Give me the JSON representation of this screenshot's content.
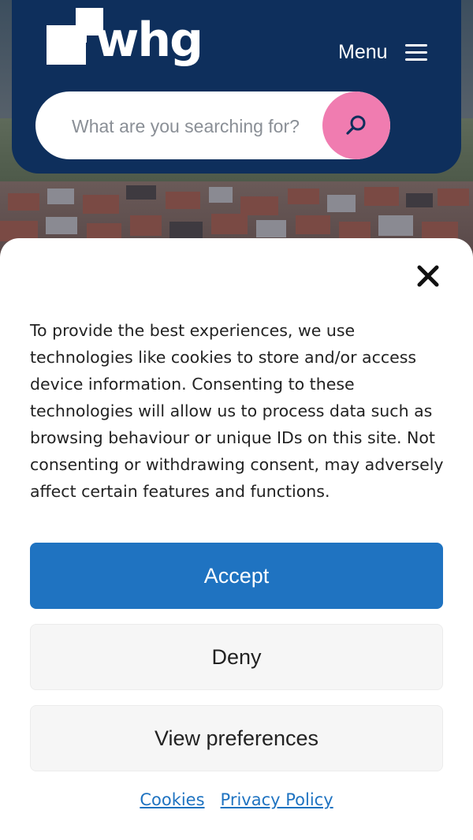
{
  "header": {
    "logo_text": "whg",
    "menu_label": "Menu",
    "search": {
      "placeholder": "What are you searching for?"
    }
  },
  "cookie_dialog": {
    "message": "To provide the best experiences, we use technologies like cookies to store and/or access device information. Consenting to these technologies will allow us to process data such as browsing behaviour or unique IDs on this site. Not consenting or withdrawing consent, may adversely affect certain features and functions.",
    "accept_label": "Accept",
    "deny_label": "Deny",
    "preferences_label": "View preferences",
    "links": [
      {
        "label": "Cookies"
      },
      {
        "label": "Privacy Policy"
      }
    ]
  },
  "colors": {
    "header_bg": "#0e2f5c",
    "search_button": "#f07cb0",
    "accent": "#1f73c1"
  },
  "icons": {
    "menu": "hamburger-icon",
    "search": "search-icon",
    "close": "close-icon"
  }
}
